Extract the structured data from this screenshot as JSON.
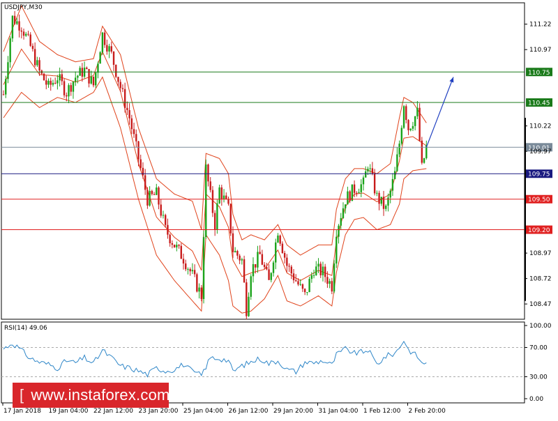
{
  "chart_data": [
    {
      "type": "candlestick",
      "title": "USDJPY,M30",
      "x_tick_labels": [
        "17 Jan 2018",
        "19 Jan 04:00",
        "22 Jan 12:00",
        "23 Jan 20:00",
        "25 Jan 04:00",
        "26 Jan 12:00",
        "29 Jan 20:00",
        "31 Jan 04:00",
        "1 Feb 12:00",
        "2 Feb 20:00"
      ],
      "y_tick_labels": [
        "111.22",
        "110.97",
        "110.22",
        "109.97",
        "108.97",
        "108.72",
        "108.47"
      ],
      "ylim": [
        108.32,
        111.43
      ],
      "close_path": [
        [
          0,
          110.53
        ],
        [
          2,
          111.28
        ],
        [
          4,
          111.2
        ],
        [
          6,
          111.0
        ],
        [
          8,
          110.75
        ],
        [
          10,
          110.6
        ],
        [
          12,
          110.7
        ],
        [
          14,
          110.55
        ],
        [
          16,
          110.7
        ],
        [
          18,
          110.77
        ],
        [
          20,
          110.62
        ],
        [
          22,
          111.12
        ],
        [
          24,
          110.92
        ],
        [
          26,
          110.6
        ],
        [
          28,
          110.3
        ],
        [
          30,
          109.9
        ],
        [
          32,
          109.5
        ],
        [
          34,
          109.55
        ],
        [
          36,
          109.2
        ],
        [
          38,
          109.05
        ],
        [
          40,
          108.92
        ],
        [
          42,
          108.75
        ],
        [
          44,
          108.55
        ],
        [
          45,
          109.8
        ],
        [
          47,
          109.25
        ],
        [
          48,
          109.6
        ],
        [
          50,
          109.4
        ],
        [
          51,
          109.0
        ],
        [
          53,
          108.9
        ],
        [
          54,
          108.42
        ],
        [
          55,
          108.8
        ],
        [
          57,
          108.95
        ],
        [
          59,
          108.68
        ],
        [
          61,
          109.2
        ],
        [
          63,
          108.85
        ],
        [
          65,
          108.7
        ],
        [
          67,
          108.55
        ],
        [
          69,
          108.82
        ],
        [
          71,
          108.78
        ],
        [
          73,
          108.65
        ],
        [
          74,
          109.2
        ],
        [
          76,
          109.5
        ],
        [
          78,
          109.6
        ],
        [
          80,
          109.65
        ],
        [
          81,
          109.85
        ],
        [
          83,
          109.52
        ],
        [
          85,
          109.4
        ],
        [
          87,
          109.75
        ],
        [
          88,
          110.05
        ],
        [
          89,
          110.45
        ],
        [
          90,
          110.2
        ],
        [
          92,
          110.35
        ],
        [
          93,
          109.8
        ],
        [
          94,
          110.01
        ]
      ],
      "bollinger_bands": {
        "upper": [
          [
            0,
            110.95
          ],
          [
            4,
            111.4
          ],
          [
            8,
            111.05
          ],
          [
            12,
            110.92
          ],
          [
            16,
            110.85
          ],
          [
            20,
            110.88
          ],
          [
            22,
            111.2
          ],
          [
            26,
            110.92
          ],
          [
            30,
            110.2
          ],
          [
            34,
            109.7
          ],
          [
            38,
            109.55
          ],
          [
            42,
            109.48
          ],
          [
            44,
            109.2
          ],
          [
            45,
            109.95
          ],
          [
            48,
            109.9
          ],
          [
            50,
            109.75
          ],
          [
            51,
            109.35
          ],
          [
            53,
            109.1
          ],
          [
            55,
            109.15
          ],
          [
            58,
            109.1
          ],
          [
            61,
            109.25
          ],
          [
            63,
            109.05
          ],
          [
            66,
            108.95
          ],
          [
            70,
            109.05
          ],
          [
            73,
            109.05
          ],
          [
            74,
            109.4
          ],
          [
            76,
            109.7
          ],
          [
            78,
            109.8
          ],
          [
            80,
            109.8
          ],
          [
            83,
            109.75
          ],
          [
            86,
            109.85
          ],
          [
            88,
            110.3
          ],
          [
            89,
            110.5
          ],
          [
            91,
            110.45
          ],
          [
            94,
            110.25
          ]
        ],
        "lower": [
          [
            0,
            110.3
          ],
          [
            4,
            110.55
          ],
          [
            8,
            110.4
          ],
          [
            12,
            110.5
          ],
          [
            16,
            110.45
          ],
          [
            20,
            110.55
          ],
          [
            22,
            110.7
          ],
          [
            26,
            110.2
          ],
          [
            30,
            109.5
          ],
          [
            34,
            108.95
          ],
          [
            38,
            108.7
          ],
          [
            42,
            108.5
          ],
          [
            44,
            108.4
          ],
          [
            45,
            109.15
          ],
          [
            48,
            108.95
          ],
          [
            50,
            108.7
          ],
          [
            51,
            108.45
          ],
          [
            53,
            108.38
          ],
          [
            55,
            108.4
          ],
          [
            58,
            108.52
          ],
          [
            61,
            108.75
          ],
          [
            63,
            108.5
          ],
          [
            66,
            108.45
          ],
          [
            70,
            108.55
          ],
          [
            73,
            108.45
          ],
          [
            74,
            108.78
          ],
          [
            76,
            109.15
          ],
          [
            78,
            109.3
          ],
          [
            80,
            109.32
          ],
          [
            83,
            109.2
          ],
          [
            86,
            109.25
          ],
          [
            88,
            109.45
          ],
          [
            89,
            109.7
          ],
          [
            91,
            109.78
          ],
          [
            94,
            109.8
          ]
        ]
      },
      "levels": [
        {
          "label": "110.75",
          "value": 110.75,
          "color": "#1a7a1a"
        },
        {
          "label": "110.45",
          "value": 110.45,
          "color": "#1a7a1a"
        },
        {
          "label": "110.01",
          "value": 110.01,
          "color": "#7a8a99"
        },
        {
          "label": "109.75",
          "value": 109.75,
          "color": "#1a1a80"
        },
        {
          "label": "109.50",
          "value": 109.5,
          "color": "#e02020"
        },
        {
          "label": "109.20",
          "value": 109.2,
          "color": "#e02020"
        }
      ],
      "forecast_arrow": {
        "from": [
          94,
          110.01
        ],
        "to": [
          100,
          110.7
        ],
        "color": "#1f3fc0"
      },
      "colors": {
        "bull": "#1aa31a",
        "bear": "#c81b1b",
        "band": "#e0431b",
        "axis": "#000000"
      }
    },
    {
      "type": "line",
      "title": "RSI(14) 49.06",
      "ylim": [
        0,
        100
      ],
      "y_tick_labels": [
        "100.00",
        "70.00",
        "30.00",
        "0.00"
      ],
      "reference_levels": [
        70,
        30
      ],
      "series": [
        {
          "color": "#2e86c8",
          "values": [
            [
              0,
              68
            ],
            [
              2,
              76
            ],
            [
              4,
              66
            ],
            [
              6,
              55
            ],
            [
              8,
              50
            ],
            [
              10,
              47
            ],
            [
              12,
              42
            ],
            [
              14,
              52
            ],
            [
              16,
              49
            ],
            [
              18,
              56
            ],
            [
              20,
              48
            ],
            [
              22,
              66
            ],
            [
              24,
              56
            ],
            [
              26,
              45
            ],
            [
              28,
              42
            ],
            [
              30,
              38
            ],
            [
              32,
              33
            ],
            [
              34,
              42
            ],
            [
              36,
              38
            ],
            [
              38,
              40
            ],
            [
              40,
              47
            ],
            [
              42,
              37
            ],
            [
              44,
              32
            ],
            [
              46,
              56
            ],
            [
              48,
              55
            ],
            [
              50,
              52
            ],
            [
              51,
              37
            ],
            [
              53,
              45
            ],
            [
              55,
              50
            ],
            [
              57,
              55
            ],
            [
              59,
              48
            ],
            [
              61,
              52
            ],
            [
              63,
              40
            ],
            [
              65,
              37
            ],
            [
              67,
              50
            ],
            [
              69,
              49
            ],
            [
              71,
              52
            ],
            [
              73,
              46
            ],
            [
              74,
              60
            ],
            [
              76,
              68
            ],
            [
              78,
              62
            ],
            [
              80,
              64
            ],
            [
              81,
              67
            ],
            [
              83,
              47
            ],
            [
              85,
              58
            ],
            [
              87,
              62
            ],
            [
              88,
              70
            ],
            [
              89,
              80
            ],
            [
              90,
              67
            ],
            [
              92,
              58
            ],
            [
              93,
              48
            ],
            [
              94,
              49.06
            ]
          ]
        }
      ]
    }
  ],
  "watermark": {
    "bracket": "[",
    "text": "www.instaforex.com",
    "bracket_close": "]"
  }
}
